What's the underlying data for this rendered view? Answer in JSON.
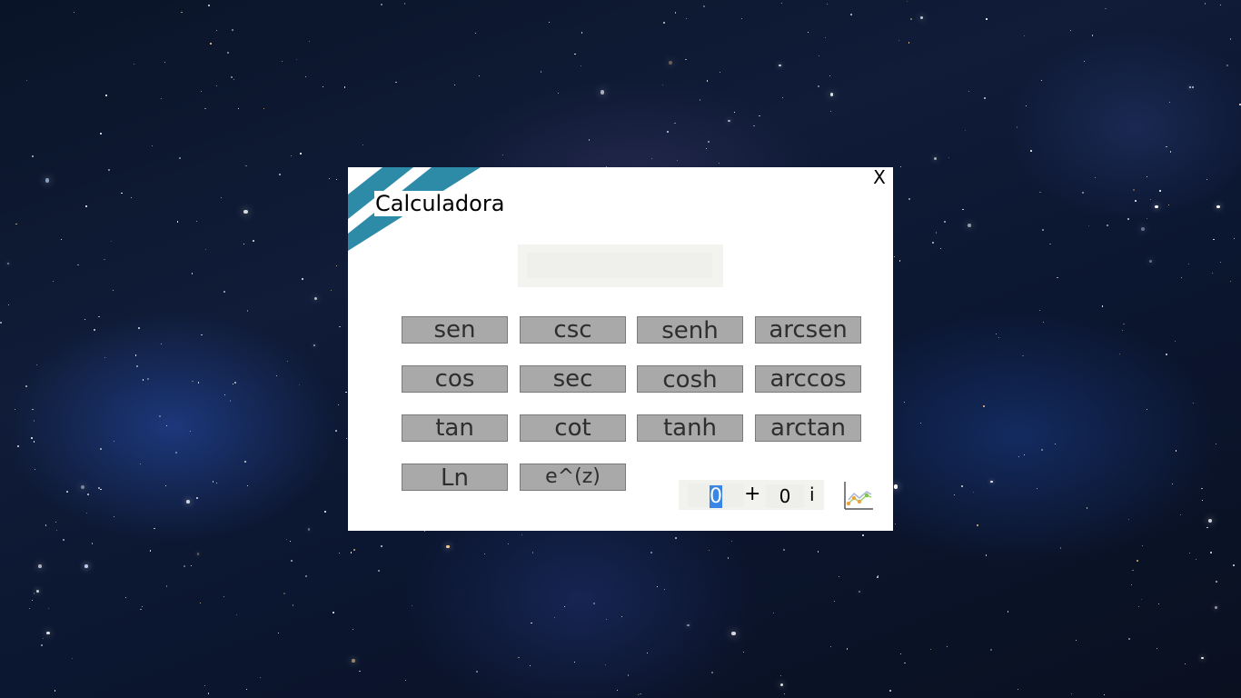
{
  "window": {
    "title": "Calculadora",
    "close_label": "X",
    "accent_color": "#2e8ba7"
  },
  "display": {
    "value": ""
  },
  "buttons": {
    "row1": [
      "sen",
      "csc",
      "senh",
      "arcsen"
    ],
    "row2": [
      "cos",
      "sec",
      "cosh",
      "arccos"
    ],
    "row3": [
      "tan",
      "cot",
      "tanh",
      "arctan"
    ],
    "row4": [
      "Ln",
      "e^(z)"
    ]
  },
  "complex": {
    "real": "0",
    "plus": "+",
    "imag": "0",
    "unit": "i"
  },
  "icons": {
    "graph": "line-chart-icon",
    "close": "close-icon"
  }
}
